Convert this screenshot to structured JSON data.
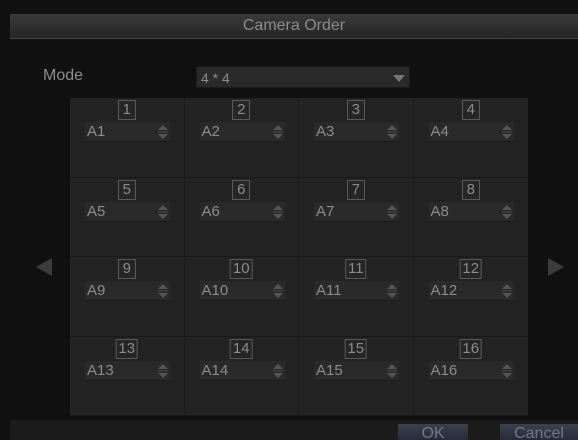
{
  "dialog": {
    "title": "Camera Order"
  },
  "mode": {
    "label": "Mode",
    "value": "4 * 4"
  },
  "cells": [
    {
      "num": "1",
      "camera": "A1"
    },
    {
      "num": "2",
      "camera": "A2"
    },
    {
      "num": "3",
      "camera": "A3"
    },
    {
      "num": "4",
      "camera": "A4"
    },
    {
      "num": "5",
      "camera": "A5"
    },
    {
      "num": "6",
      "camera": "A6"
    },
    {
      "num": "7",
      "camera": "A7"
    },
    {
      "num": "8",
      "camera": "A8"
    },
    {
      "num": "9",
      "camera": "A9"
    },
    {
      "num": "10",
      "camera": "A10"
    },
    {
      "num": "11",
      "camera": "A11"
    },
    {
      "num": "12",
      "camera": "A12"
    },
    {
      "num": "13",
      "camera": "A13"
    },
    {
      "num": "14",
      "camera": "A14"
    },
    {
      "num": "15",
      "camera": "A15"
    },
    {
      "num": "16",
      "camera": "A16"
    }
  ],
  "buttons": {
    "ok": "OK",
    "cancel": "Cancel"
  }
}
